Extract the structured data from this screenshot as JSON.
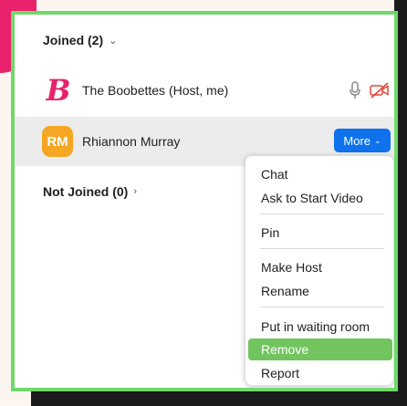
{
  "joined_section": {
    "label": "Joined (2)",
    "chevron": "⌄"
  },
  "participants": [
    {
      "name": "The Boobettes (Host, me)",
      "logo_letter": "B",
      "logo_color": "#e8236b"
    },
    {
      "name": "Rhiannon Murray",
      "initials": "RM",
      "avatar_color": "#f5a623"
    }
  ],
  "more_button": {
    "label": "More",
    "chevron": "⌄",
    "color": "#0e72ed"
  },
  "not_joined_section": {
    "label": "Not Joined (0)",
    "chevron": "›"
  },
  "menu": {
    "items": [
      "Chat",
      "Ask to Start Video",
      "Pin",
      "Make Host",
      "Rename",
      "Put in waiting room",
      "Remove",
      "Report"
    ],
    "highlighted": "Remove",
    "highlight_color": "#71c45e"
  },
  "colors": {
    "frame_border": "#6fd96a",
    "brand_pink": "#e8236b"
  }
}
